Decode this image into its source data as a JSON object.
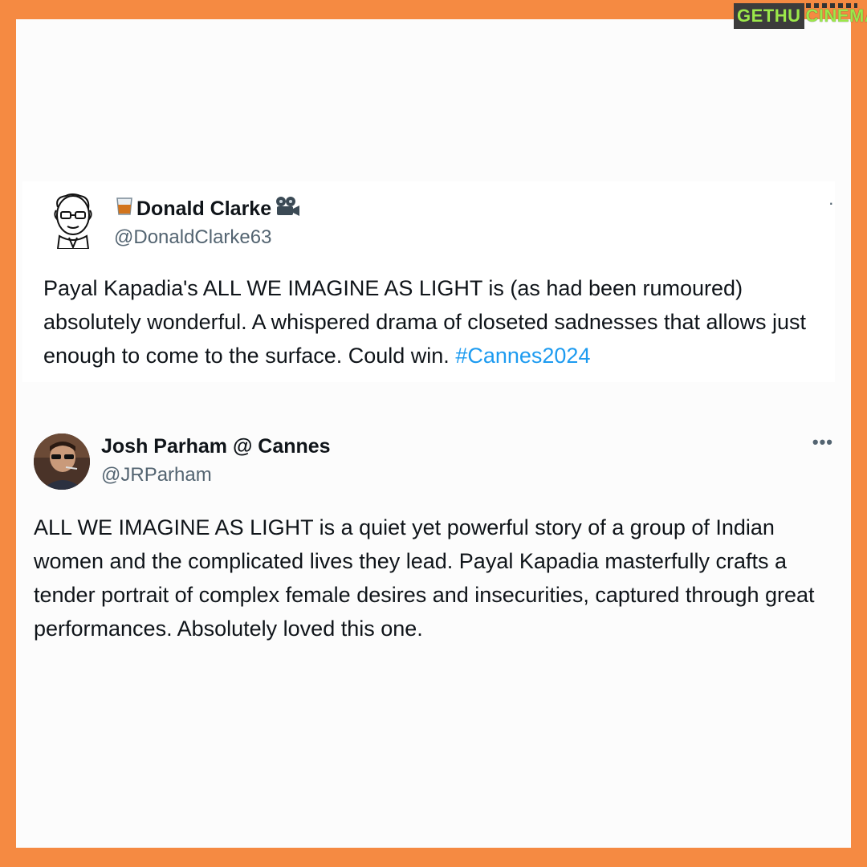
{
  "logo": {
    "part1": "GETHU",
    "part2": "CINEMA"
  },
  "tweets": [
    {
      "name": "Donald Clarke",
      "name_prefix_icon": "whisky-glass-icon",
      "name_suffix_icon": "film-camera-icon",
      "handle": "@DonaldClarke63",
      "more": "·",
      "text": "Payal Kapadia's ALL WE IMAGINE AS LIGHT is (as had been rumoured) absolutely wonderful. A whispered drama of closeted sadnesses that allows just enough to come to the surface. Could win. ",
      "hashtag": "#Cannes2024"
    },
    {
      "name": "Josh Parham @ Cannes",
      "handle": "@JRParham",
      "more": "•••",
      "text": "ALL WE IMAGINE AS LIGHT is a quiet yet powerful story of a group of Indian women and the complicated lives they lead. Payal Kapadia masterfully crafts a tender portrait of complex female desires and insecurities, captured through great performances. Absolutely loved this one."
    }
  ],
  "colors": {
    "frame": "#F58A42",
    "hashtag": "#1D9BF0",
    "handle": "#536471"
  }
}
